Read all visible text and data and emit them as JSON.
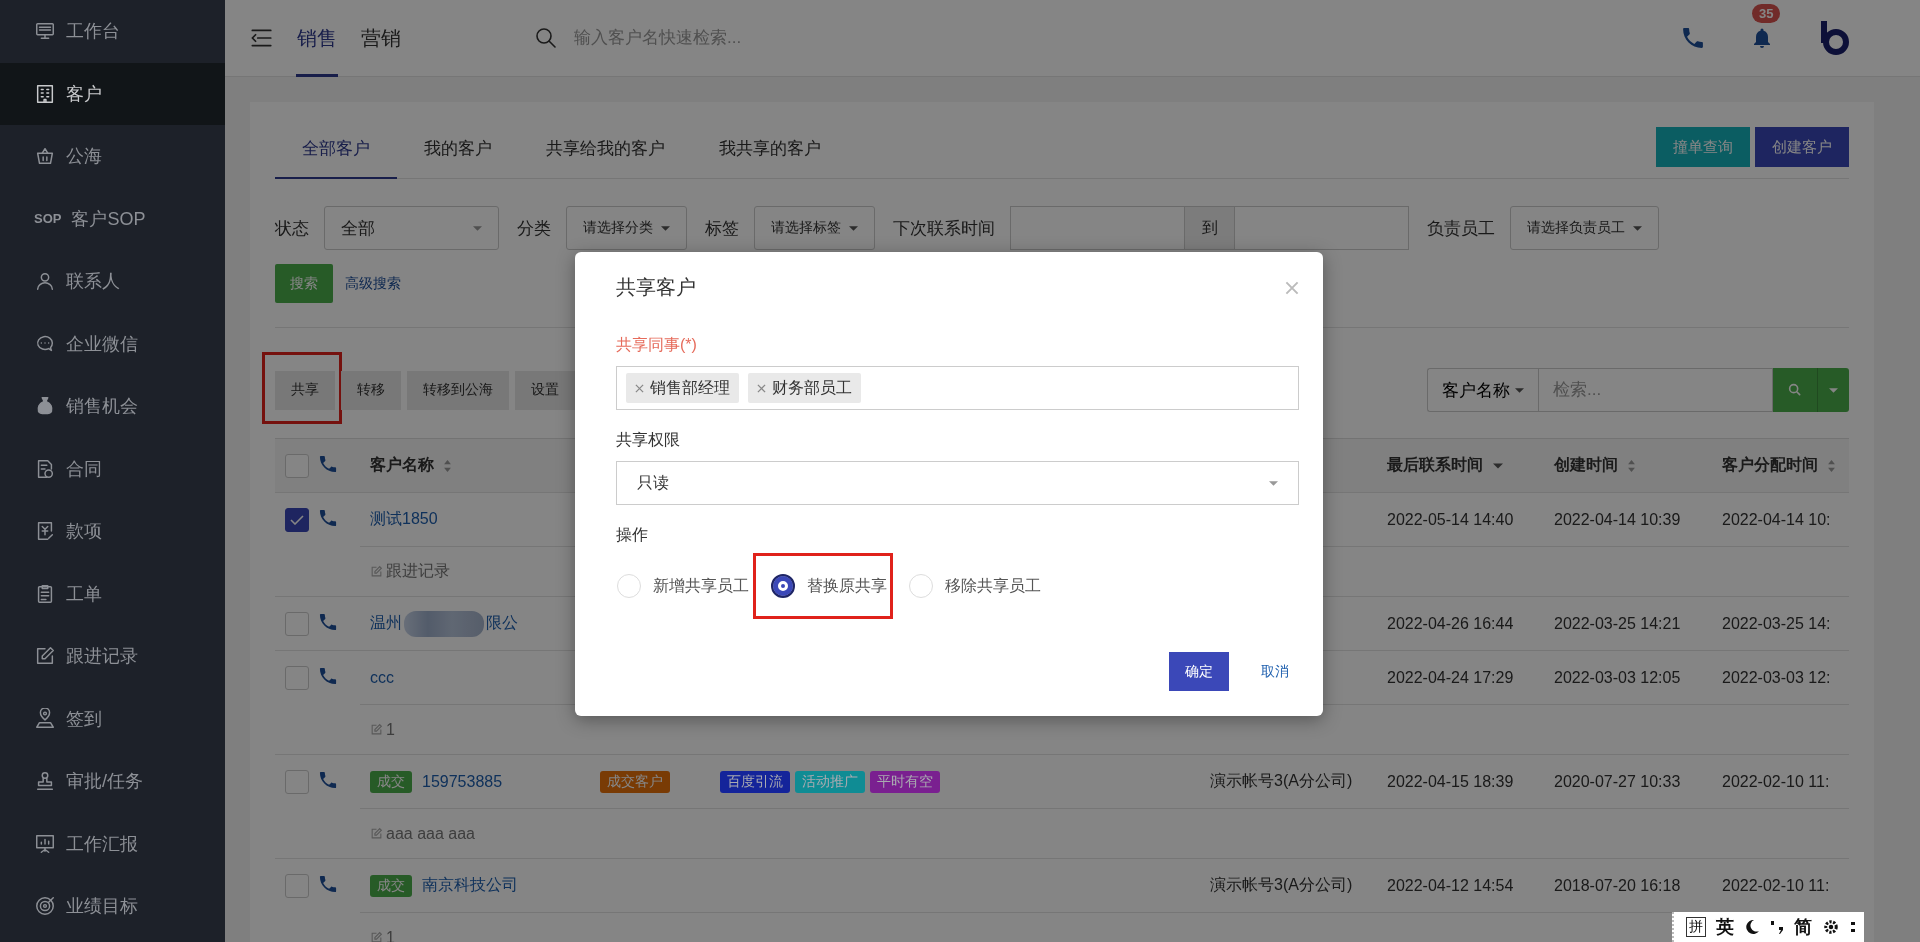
{
  "sidebar": {
    "items": [
      {
        "label": "工作台",
        "selected": false
      },
      {
        "label": "客户",
        "selected": true
      },
      {
        "label": "公海",
        "selected": false
      },
      {
        "label": "客户SOP",
        "icon_text": "SOP",
        "selected": false
      },
      {
        "label": "联系人",
        "selected": false
      },
      {
        "label": "企业微信",
        "selected": false
      },
      {
        "label": "销售机会",
        "selected": false
      },
      {
        "label": "合同",
        "selected": false
      },
      {
        "label": "款项",
        "selected": false
      },
      {
        "label": "工单",
        "selected": false
      },
      {
        "label": "跟进记录",
        "selected": false
      },
      {
        "label": "签到",
        "selected": false
      },
      {
        "label": "审批/任务",
        "selected": false
      },
      {
        "label": "工作汇报",
        "selected": false
      },
      {
        "label": "业绩目标",
        "selected": false
      }
    ]
  },
  "topbar": {
    "tabs": [
      {
        "label": "销售",
        "selected": true
      },
      {
        "label": "营销",
        "selected": false
      }
    ],
    "search": {
      "placeholder": "输入客户名快速检索..."
    },
    "notification_count": "35"
  },
  "page": {
    "tabs": [
      {
        "label": "全部客户",
        "selected": true
      },
      {
        "label": "我的客户",
        "selected": false
      },
      {
        "label": "共享给我的客户",
        "selected": false
      },
      {
        "label": "我共享的客户",
        "selected": false
      }
    ],
    "actions": [
      {
        "label": "撞单查询",
        "kind": "info"
      },
      {
        "label": "创建客户",
        "kind": "primary"
      }
    ],
    "filters": [
      {
        "kind": "select",
        "label": "状态",
        "value": "全部"
      },
      {
        "kind": "dropdown",
        "label": "分类",
        "value": "请选择分类"
      },
      {
        "kind": "dropdown",
        "label": "标签",
        "value": "请选择标签"
      },
      {
        "kind": "daterange",
        "label": "下次联系时间",
        "separator": "到"
      },
      {
        "kind": "dropdown",
        "label": "负责员工",
        "value": "请选择负责员工"
      }
    ],
    "search_button": "搜索",
    "advanced_search": "高级搜索",
    "toolbar": [
      {
        "label": "共享",
        "highlighted": true
      },
      {
        "label": "转移",
        "highlighted": false
      },
      {
        "label": "转移到公海",
        "highlighted": false
      },
      {
        "label": "设置",
        "highlighted": false
      }
    ],
    "table_search": {
      "field": "客户名称",
      "placeholder": "检索..."
    }
  },
  "table": {
    "all_selected": false,
    "columns": [
      {
        "label": "客户名称",
        "sorted": false
      },
      {
        "label": "最后联系时间",
        "sorted": true
      },
      {
        "label": "创建时间",
        "sorted": false
      },
      {
        "label": "客户分配时间",
        "sorted": false
      }
    ],
    "rows": [
      {
        "selected": true,
        "name": "测试1850",
        "note": "跟进记录",
        "last_contact": "2022-05-14 14:40",
        "created": "2022-04-14 10:39",
        "assigned": "2022-04-14 10:"
      },
      {
        "selected": false,
        "name": "温州",
        "redacted": true,
        "name_end": "限公",
        "last_contact": "2022-04-26 16:44",
        "created": "2022-03-25 14:21",
        "assigned": "2022-03-25 14:"
      },
      {
        "selected": false,
        "name": "ccc",
        "note": "1",
        "last_contact": "2022-04-24 17:29",
        "created": "2022-03-03 12:05",
        "assigned": "2022-03-03 12:"
      },
      {
        "selected": false,
        "status": "成交",
        "name": "159753885",
        "stage": "成交客户",
        "tags": [
          {
            "label": "百度引流",
            "color": "#14249a"
          },
          {
            "label": "活动推广",
            "color": "#0f8c94"
          },
          {
            "label": "平时有空",
            "color": "#7a2090"
          }
        ],
        "owner": "演示帐号3(A分公司)",
        "note": "aaa aaa aaa",
        "last_contact": "2022-04-15 18:39",
        "created": "2020-07-27 10:33",
        "assigned": "2022-02-10 11:"
      },
      {
        "selected": false,
        "status": "成交",
        "name": "南京科技公司",
        "owner": "演示帐号3(A分公司)",
        "note": "1",
        "last_contact": "2022-04-12 14:54",
        "created": "2018-07-20 16:18",
        "assigned": "2022-02-10 11:"
      }
    ]
  },
  "dialog": {
    "title": "共享客户",
    "colleagues": {
      "label": "共享同事(*)",
      "required": true,
      "tags": [
        "销售部经理",
        "财务部员工"
      ]
    },
    "permission": {
      "label": "共享权限",
      "value": "只读"
    },
    "operation": {
      "label": "操作",
      "options": [
        {
          "label": "新增共享员工",
          "selected": false,
          "highlighted": false
        },
        {
          "label": "替换原共享",
          "selected": true,
          "highlighted": true
        },
        {
          "label": "移除共享员工",
          "selected": false,
          "highlighted": false
        }
      ]
    },
    "buttons": [
      {
        "label": "确定",
        "kind": "primary"
      },
      {
        "label": "取消",
        "kind": "link"
      }
    ]
  },
  "ime_toolbar": {
    "labels": [
      "拼",
      "英",
      "简"
    ]
  }
}
